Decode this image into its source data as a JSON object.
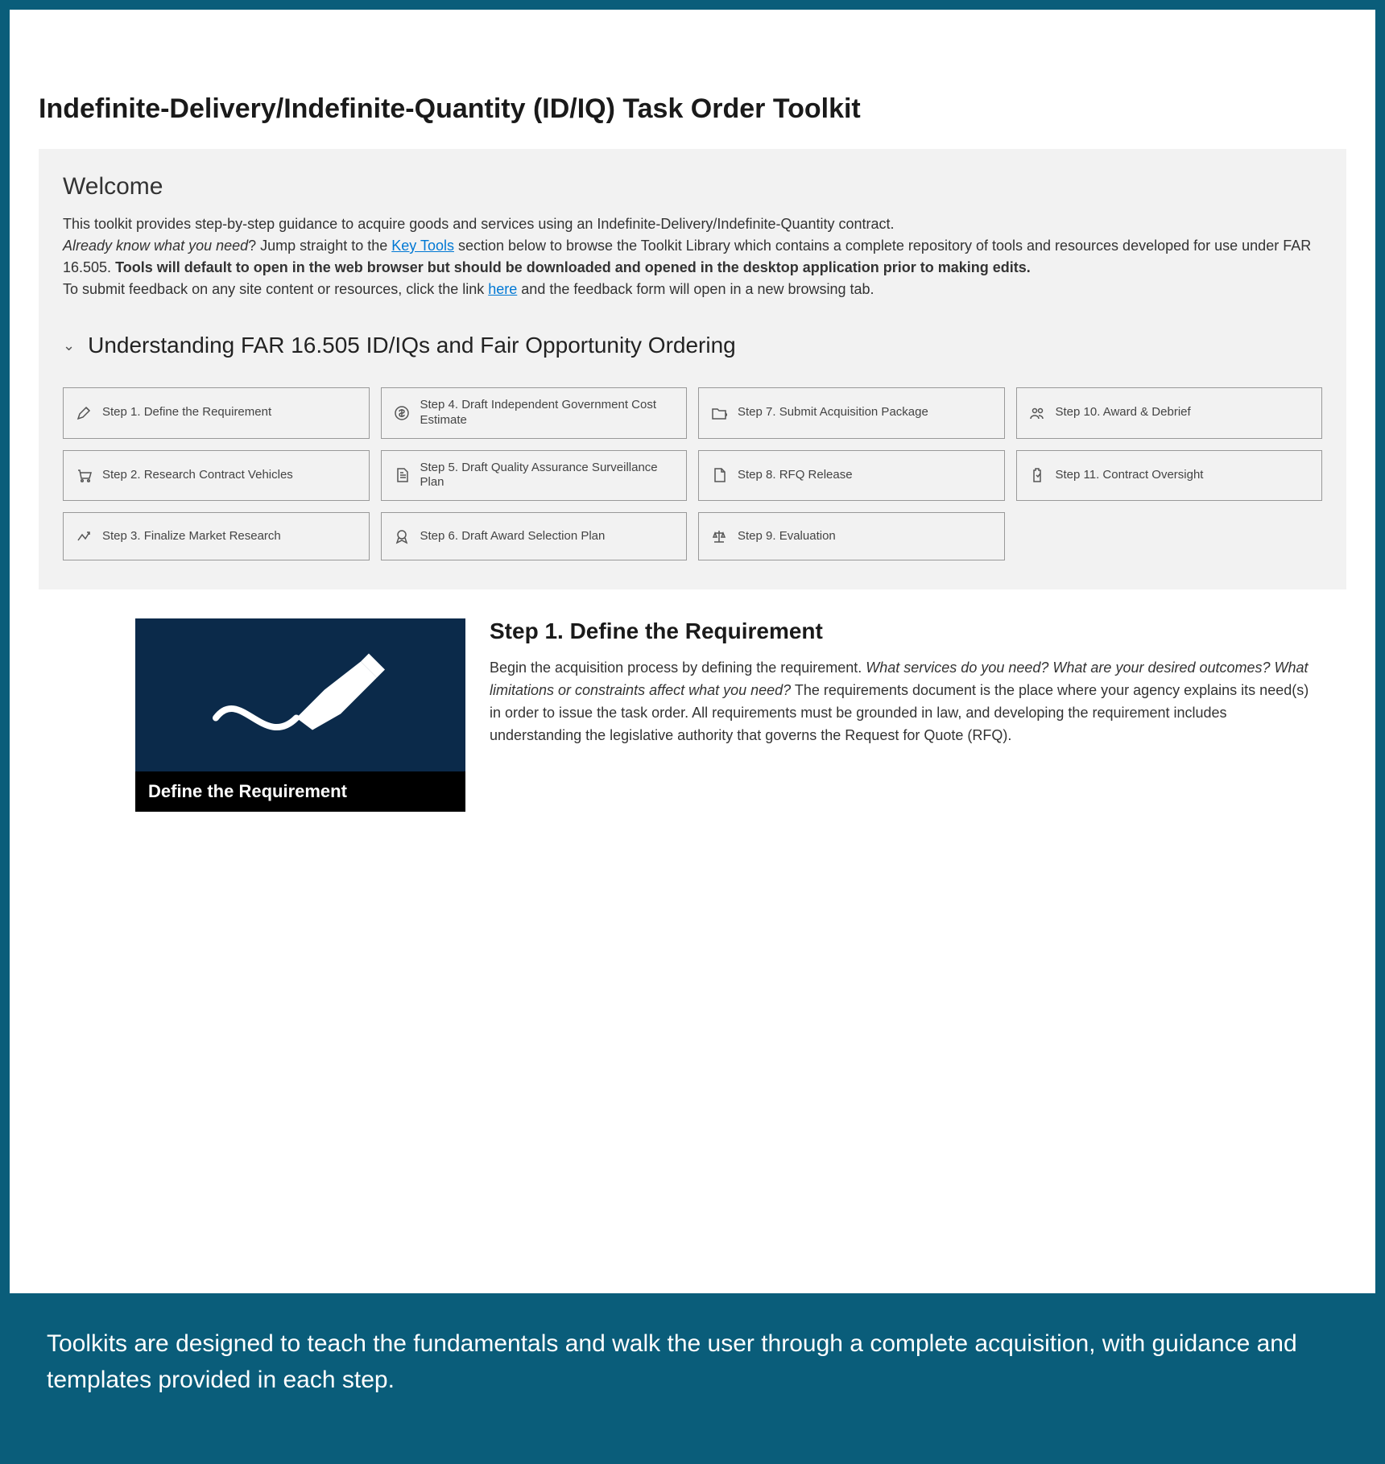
{
  "page": {
    "title": "Indefinite-Delivery/Indefinite-Quantity (ID/IQ) Task Order Toolkit"
  },
  "welcome": {
    "heading": "Welcome",
    "p1a": "This toolkit provides step-by-step guidance to acquire goods and services using an Indefinite-Delivery/Indefinite-Quantity contract.",
    "p1b_em": "Already know what you need",
    "p1b_after_em": "? Jump straight to the ",
    "key_tools_link": "Key Tools",
    "p1c": " section below to browse the Toolkit Library which contains a complete repository of tools and resources developed for use under FAR 16.505. ",
    "p1_bold": "Tools will default to open in the web browser but should be downloaded and opened in the desktop application prior to making edits.",
    "p2a": "To submit feedback on any site content or resources, click the link ",
    "here_link": "here",
    "p2b": " and the feedback form will open in a new browsing tab."
  },
  "expand": {
    "title": "Understanding FAR 16.505 ID/IQs and Fair Opportunity Ordering"
  },
  "steps": [
    {
      "label": "Step 1. Define the Requirement",
      "icon": "pencil"
    },
    {
      "label": "Step 4. Draft Independent Government Cost Estimate",
      "icon": "dollar"
    },
    {
      "label": "Step 7. Submit Acquisition Package",
      "icon": "folder"
    },
    {
      "label": "Step 10. Award & Debrief",
      "icon": "people"
    },
    {
      "label": "Step 2. Research Contract Vehicles",
      "icon": "cart"
    },
    {
      "label": "Step 5. Draft Quality Assurance Surveillance Plan",
      "icon": "document"
    },
    {
      "label": "Step 8. RFQ Release",
      "icon": "page"
    },
    {
      "label": "Step 11. Contract Oversight",
      "icon": "clipboard"
    },
    {
      "label": "Step 3. Finalize Market Research",
      "icon": "arrowup"
    },
    {
      "label": "Step 6. Draft Award Selection Plan",
      "icon": "ribbon"
    },
    {
      "label": "Step 9. Evaluation",
      "icon": "scales"
    }
  ],
  "detail": {
    "image_caption": "Define the Requirement",
    "heading": "Step 1. Define the Requirement",
    "body_a": "Begin the acquisition process by defining the requirement. ",
    "body_em": "What services do you need? What are your desired outcomes? What limitations or constraints affect what you need?",
    "body_b": " The requirements document is the place where your agency explains its need(s) in order to issue the task order. All requirements must be grounded in law, and developing the requirement includes understanding the legislative authority that governs the Request for Quote (RFQ)."
  },
  "footer": {
    "text": "Toolkits are designed to teach the fundamentals and walk the user through a complete acquisition, with guidance and templates provided in each step."
  }
}
